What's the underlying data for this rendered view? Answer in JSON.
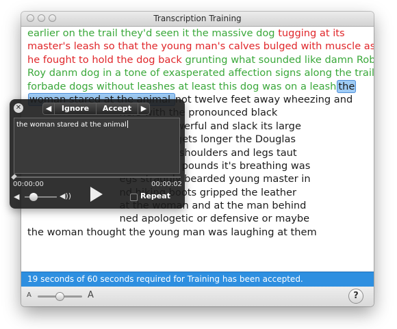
{
  "window": {
    "title": "Transcription Training"
  },
  "transcript": {
    "lines": [
      [
        {
          "t": "earlier on the trail they'd seen it the massive dog ",
          "c": "g"
        },
        {
          "t": "tugging at its",
          "c": "r"
        }
      ],
      [
        {
          "t": "master's leash so that the young man's calves bulged with muscle as",
          "c": "r"
        }
      ],
      [
        {
          "t": "he fought to hold the dog back ",
          "c": "r"
        },
        {
          "t": "grunting what sounded like damn Rob",
          "c": "g"
        }
      ],
      [
        {
          "t": "Roy danm dog in a tone of exasperated affection signs along the trail",
          "c": "g"
        }
      ],
      [
        {
          "t": "forbade dogs without leashes at least this dog was on a leash",
          "c": "g"
        },
        {
          "t": "the",
          "c": "hl"
        }
      ],
      [
        {
          "t": "woman stared at the animal ",
          "c": "hl"
        },
        {
          "t": "not twelve feet away wheezing and",
          "c": "n"
        }
      ],
      [
        {
          "t": "                             hers with the pronounced black",
          "c": "n"
        }
      ],
      [
        {
          "t": "                             ws were powerful and slack its large",
          "c": "n"
        }
      ],
      [
        {
          "t": "                             xual organ gets longer the Douglas",
          "c": "n"
        }
      ],
      [
        {
          "t": "                             hest strong shoulders and legs taut",
          "c": "n"
        }
      ],
      [
        {
          "t": "                             wo hundred pounds it's breathing was",
          "c": "n"
        }
      ],
      [
        {
          "t": "                             egs straggly bearded young master in",
          "c": "n"
        }
      ],
      [
        {
          "t": "                             nd hiking boots gripped the leather",
          "c": "n"
        }
      ],
      [
        {
          "t": "                             at the woman and at the man behind",
          "c": "n"
        }
      ],
      [
        {
          "t": "                             ned apologetic or defensive or maybe",
          "c": "n"
        }
      ],
      [
        {
          "t": "the woman thought the young man was laughing at them",
          "c": "n"
        }
      ]
    ]
  },
  "hud": {
    "ignore_label": "Ignore",
    "accept_label": "Accept",
    "input_value": "the woman stared at the animal",
    "time_current": "00:00:00",
    "time_total": "00:00:02",
    "repeat_label": "Repeat",
    "repeat_checked": false
  },
  "status": {
    "text": "19 seconds of 60 seconds required for Training has been accepted."
  },
  "bottom": {
    "font_small_label": "A",
    "font_large_label": "A",
    "help_label": "?"
  },
  "colors": {
    "accepted_text": "#3aa83a",
    "rejected_text": "#e0262a",
    "selection": "#9ecbf5",
    "status_bar": "#2e8fe0"
  }
}
